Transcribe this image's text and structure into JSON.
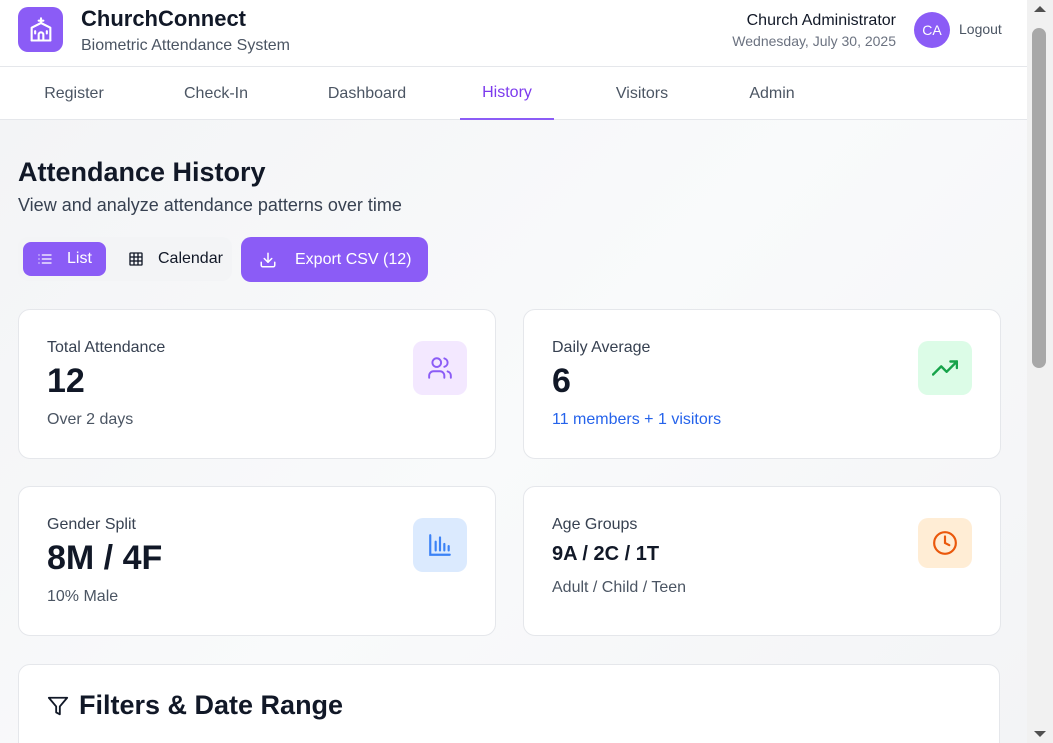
{
  "header": {
    "app_title": "ChurchConnect",
    "app_subtitle": "Biometric Attendance System",
    "user_name": "Church Administrator",
    "date": "Wednesday, July 30, 2025",
    "avatar_initials": "CA",
    "logout_label": "Logout",
    "logo_icon": "church-icon",
    "accent_color": "#8b5cf6"
  },
  "nav": {
    "tabs": [
      {
        "label": "Register"
      },
      {
        "label": "Check-In"
      },
      {
        "label": "Dashboard"
      },
      {
        "label": "History",
        "active": true
      },
      {
        "label": "Visitors"
      },
      {
        "label": "Admin"
      }
    ]
  },
  "page": {
    "title": "Attendance History",
    "subtitle": "View and analyze attendance patterns over time",
    "view_toggle": {
      "list_label": "List",
      "calendar_label": "Calendar",
      "selected": "List"
    },
    "export_label": "Export CSV (12)"
  },
  "stats": [
    {
      "label": "Total Attendance",
      "value": "12",
      "note": "Over 2 days",
      "icon": "users-icon",
      "icon_color": "#8b5cf6",
      "icon_bg": "#f3e8ff"
    },
    {
      "label": "Daily Average",
      "value": "6",
      "note": "11 members + 1 visitors",
      "icon": "trending-up-icon",
      "icon_color": "#16a34a",
      "icon_bg": "#dcfce7"
    },
    {
      "label": "Gender Split",
      "value": "8M / 4F",
      "note": "10% Male",
      "icon": "bar-chart-icon",
      "icon_color": "#3b82f6",
      "icon_bg": "#dbeafe"
    },
    {
      "label": "Age Groups",
      "value": "9A / 2C / 1T",
      "note": "Adult / Child / Teen",
      "icon": "clock-icon",
      "icon_color": "#ea580c",
      "icon_bg": "#ffedd5"
    }
  ],
  "filters": {
    "title": "Filters & Date Range",
    "icon": "filter-icon"
  }
}
